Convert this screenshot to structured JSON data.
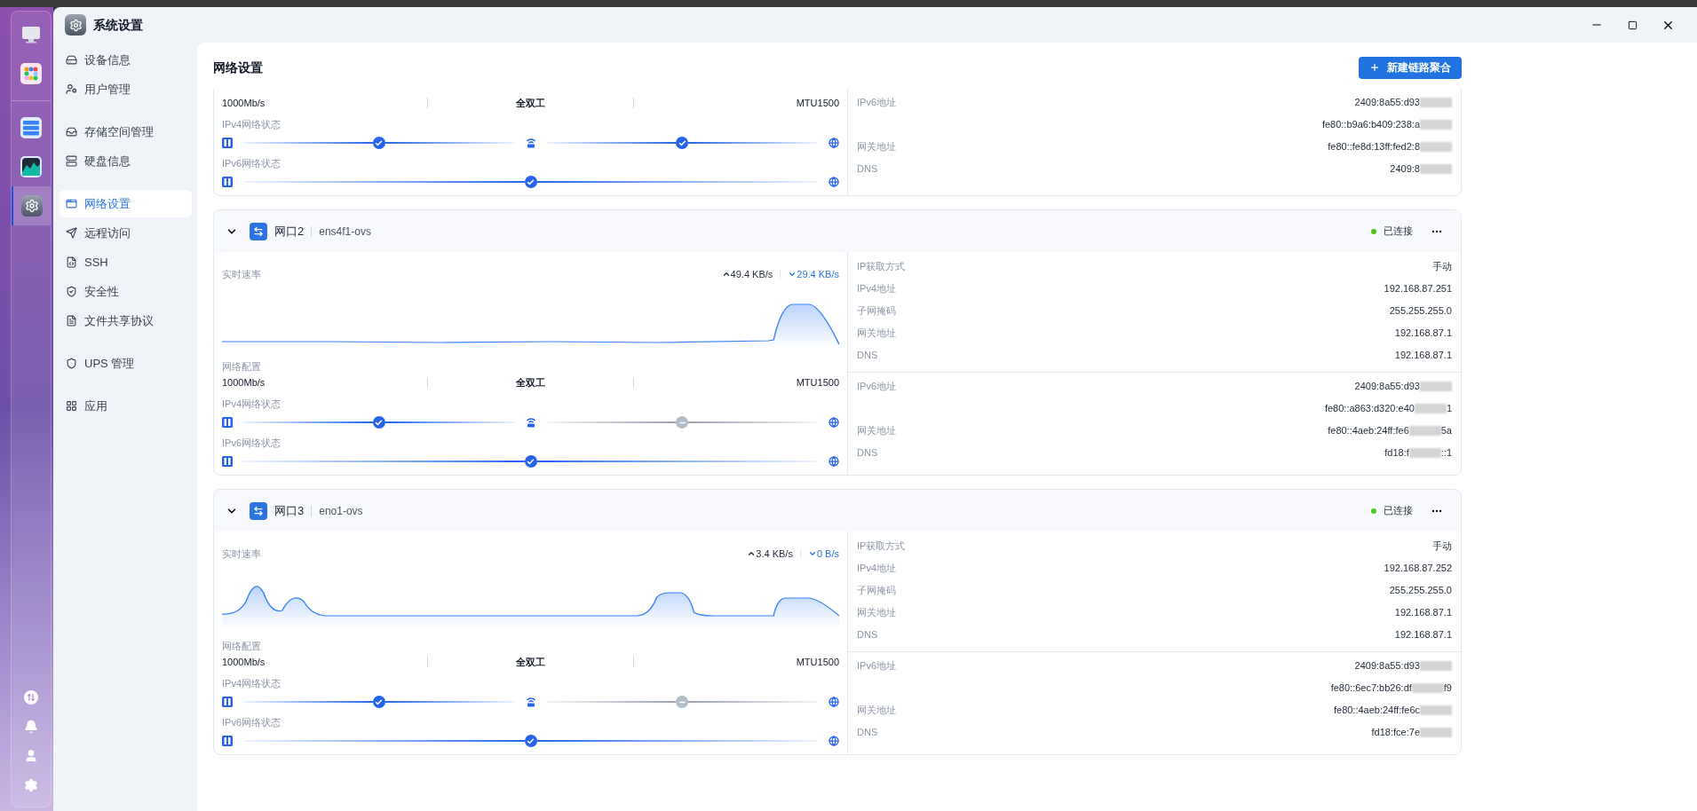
{
  "window": {
    "title": "系统设置"
  },
  "dock": [
    {
      "kind": "monitor",
      "selected": false
    },
    {
      "kind": "apps",
      "selected": false
    },
    {
      "kind": "storage",
      "selected": false
    },
    {
      "kind": "activity",
      "selected": false
    },
    {
      "kind": "settings",
      "selected": true
    }
  ],
  "sidebar": {
    "groups": [
      [
        {
          "label": "设备信息",
          "selected": false
        },
        {
          "label": "用户管理",
          "selected": false
        }
      ],
      [
        {
          "label": "存储空间管理",
          "selected": false
        },
        {
          "label": "硬盘信息",
          "selected": false
        }
      ],
      [
        {
          "label": "网络设置",
          "selected": true
        },
        {
          "label": "远程访问",
          "selected": false
        },
        {
          "label": "SSH",
          "selected": false
        },
        {
          "label": "安全性",
          "selected": false
        },
        {
          "label": "文件共享协议",
          "selected": false
        }
      ],
      [
        {
          "label": "UPS 管理",
          "selected": false
        }
      ],
      [
        {
          "label": "应用",
          "selected": false
        }
      ]
    ]
  },
  "page": {
    "title": "网络设置",
    "action_button": "新建链路聚合"
  },
  "ports": [
    {
      "config": {
        "values": [
          "1000Mb/s",
          "全双工",
          "MTU1500"
        ]
      },
      "status_rows": [
        {
          "label": "IPv4网络状态",
          "nodes": [
            {
              "ok": true
            },
            {
              "ok": true
            }
          ]
        },
        {
          "label": "IPv6网络状态",
          "nodes": [
            {
              "ok": true
            }
          ]
        }
      ],
      "ipv6": [
        {
          "label": "IPv6地址",
          "value": "2409:8a55:d93",
          "redacted": true
        },
        {
          "value": "fe80::b9a6:b409:238:a",
          "redacted": true
        },
        {
          "label": "网关地址",
          "value": "fe80::fe8d:13ff:fed2:8",
          "redacted": true
        },
        {
          "label": "DNS",
          "value": "2409:8",
          "redacted": true
        }
      ]
    },
    {
      "name": "网口2",
      "interface": "ens4f1-ovs",
      "expanded": true,
      "status": "已连接",
      "color": "#52c41a",
      "speed": {
        "label": "实时速率",
        "up": "49.4 KB/s",
        "down": "29.4 KB/s"
      },
      "config": {
        "label": "网络配置",
        "values": [
          "1000Mb/s",
          "全双工",
          "MTU1500"
        ]
      },
      "status_rows": [
        {
          "label": "IPv4网络状态",
          "nodes": [
            {
              "ok": true
            },
            {
              "ok": false
            }
          ]
        },
        {
          "label": "IPv6网络状态",
          "nodes": [
            {
              "ok": true
            }
          ]
        }
      ],
      "ipv4": [
        {
          "label": "IP获取方式",
          "value": "手动"
        },
        {
          "label": "IPv4地址",
          "value": "192.168.87.251"
        },
        {
          "label": "子网掩码",
          "value": "255.255.255.0"
        },
        {
          "label": "网关地址",
          "value": "192.168.87.1"
        },
        {
          "label": "DNS",
          "value": "192.168.87.1"
        }
      ],
      "ipv6": [
        {
          "label": "IPv6地址",
          "value": "2409:8a55:d93",
          "redacted": true
        },
        {
          "value": "fe80::a863:d320:e40",
          "redacted": true,
          "tail": "1"
        },
        {
          "label": "网关地址",
          "value": "fe80::4aeb:24ff:fe6",
          "redacted": true,
          "tail": "5a"
        },
        {
          "label": "DNS",
          "value": "fd18:f",
          "redacted": true,
          "tail": "::1"
        }
      ]
    },
    {
      "name": "网口3",
      "interface": "eno1-ovs",
      "expanded": true,
      "status": "已连接",
      "color": "#52c41a",
      "speed": {
        "label": "实时速率",
        "up": "3.4 KB/s",
        "down": "0 B/s"
      },
      "config": {
        "label": "网络配置",
        "values": [
          "1000Mb/s",
          "全双工",
          "MTU1500"
        ]
      },
      "status_rows": [
        {
          "label": "IPv4网络状态",
          "nodes": [
            {
              "ok": true
            },
            {
              "ok": false
            }
          ]
        },
        {
          "label": "IPv6网络状态",
          "nodes": [
            {
              "ok": true
            }
          ]
        }
      ],
      "ipv4": [
        {
          "label": "IP获取方式",
          "value": "手动"
        },
        {
          "label": "IPv4地址",
          "value": "192.168.87.252"
        },
        {
          "label": "子网掩码",
          "value": "255.255.255.0"
        },
        {
          "label": "网关地址",
          "value": "192.168.87.1"
        },
        {
          "label": "DNS",
          "value": "192.168.87.1"
        }
      ],
      "ipv6": [
        {
          "label": "IPv6地址",
          "value": "2409:8a55:d93",
          "redacted": true
        },
        {
          "value": "fe80::6ec7:bb26:df",
          "redacted": true,
          "tail": "f9"
        },
        {
          "label": "网关地址",
          "value": "fe80::4aeb:24ff:fe6c",
          "redacted": true
        },
        {
          "label": "DNS",
          "value": "fd18:fce:7e",
          "redacted": true
        }
      ]
    }
  ]
}
